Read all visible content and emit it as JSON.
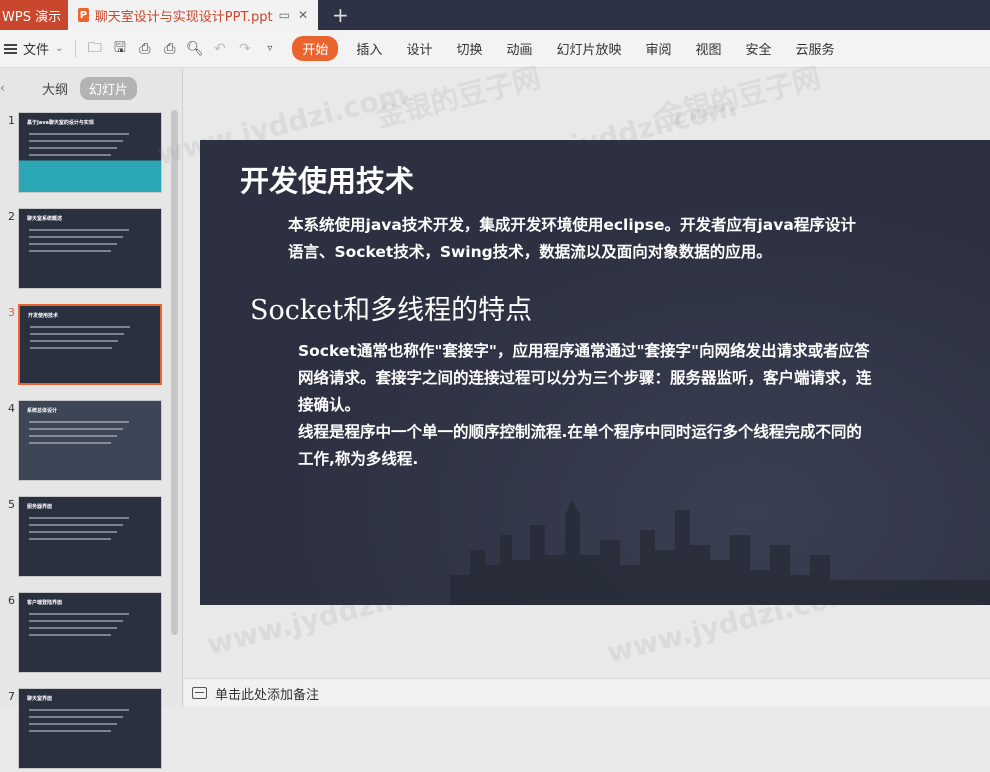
{
  "titlebar": {
    "app_name": "WPS 演示",
    "doc_title": "聊天室设计与实现设计PPT.ppt",
    "doc_icon": "P",
    "new_tab": "+"
  },
  "ribbon": {
    "file_label": "文件",
    "tabs": [
      "开始",
      "插入",
      "设计",
      "切换",
      "动画",
      "幻灯片放映",
      "审阅",
      "视图",
      "安全",
      "云服务"
    ],
    "active_tab": "开始",
    "accent": "#e9642f"
  },
  "left_panel": {
    "tab_outline": "大纲",
    "tab_slides": "幻灯片",
    "active_slide": 3,
    "slides": [
      {
        "num": "1",
        "title": "基于Java聊天室的设计与实现"
      },
      {
        "num": "2",
        "title": "聊天室系统概述"
      },
      {
        "num": "3",
        "title": "开发使用技术"
      },
      {
        "num": "4",
        "title": "系统总体设计"
      },
      {
        "num": "5",
        "title": "服务器界面"
      },
      {
        "num": "6",
        "title": "客户端登陆界面"
      },
      {
        "num": "7",
        "title": "聊天室界面"
      }
    ]
  },
  "slide": {
    "title": "开发使用技术",
    "para1": "本系统使用java技术开发，集成开发环境使用eclipse。开发者应有java程序设计语言、Socket技术，Swing技术，数据流以及面向对象数据的应用。",
    "subtitle": "Socket和多线程的特点",
    "para2_line1": "Socket通常也称作\"套接字\"，应用程序通常通过\"套接字\"向网络发出请求或者应答网络请求。套接字之间的连接过程可以分为三个步骤：服务器监听，客户端请求，连接确认。",
    "para2_line2": "线程是程序中一个单一的顺序控制流程.在单个程序中同时运行多个线程完成不同的工作,称为多线程."
  },
  "notes": {
    "placeholder": "单击此处添加备注"
  },
  "watermarks": {
    "cn": "金银的豆子网",
    "url": "www.jyddzi.com"
  }
}
